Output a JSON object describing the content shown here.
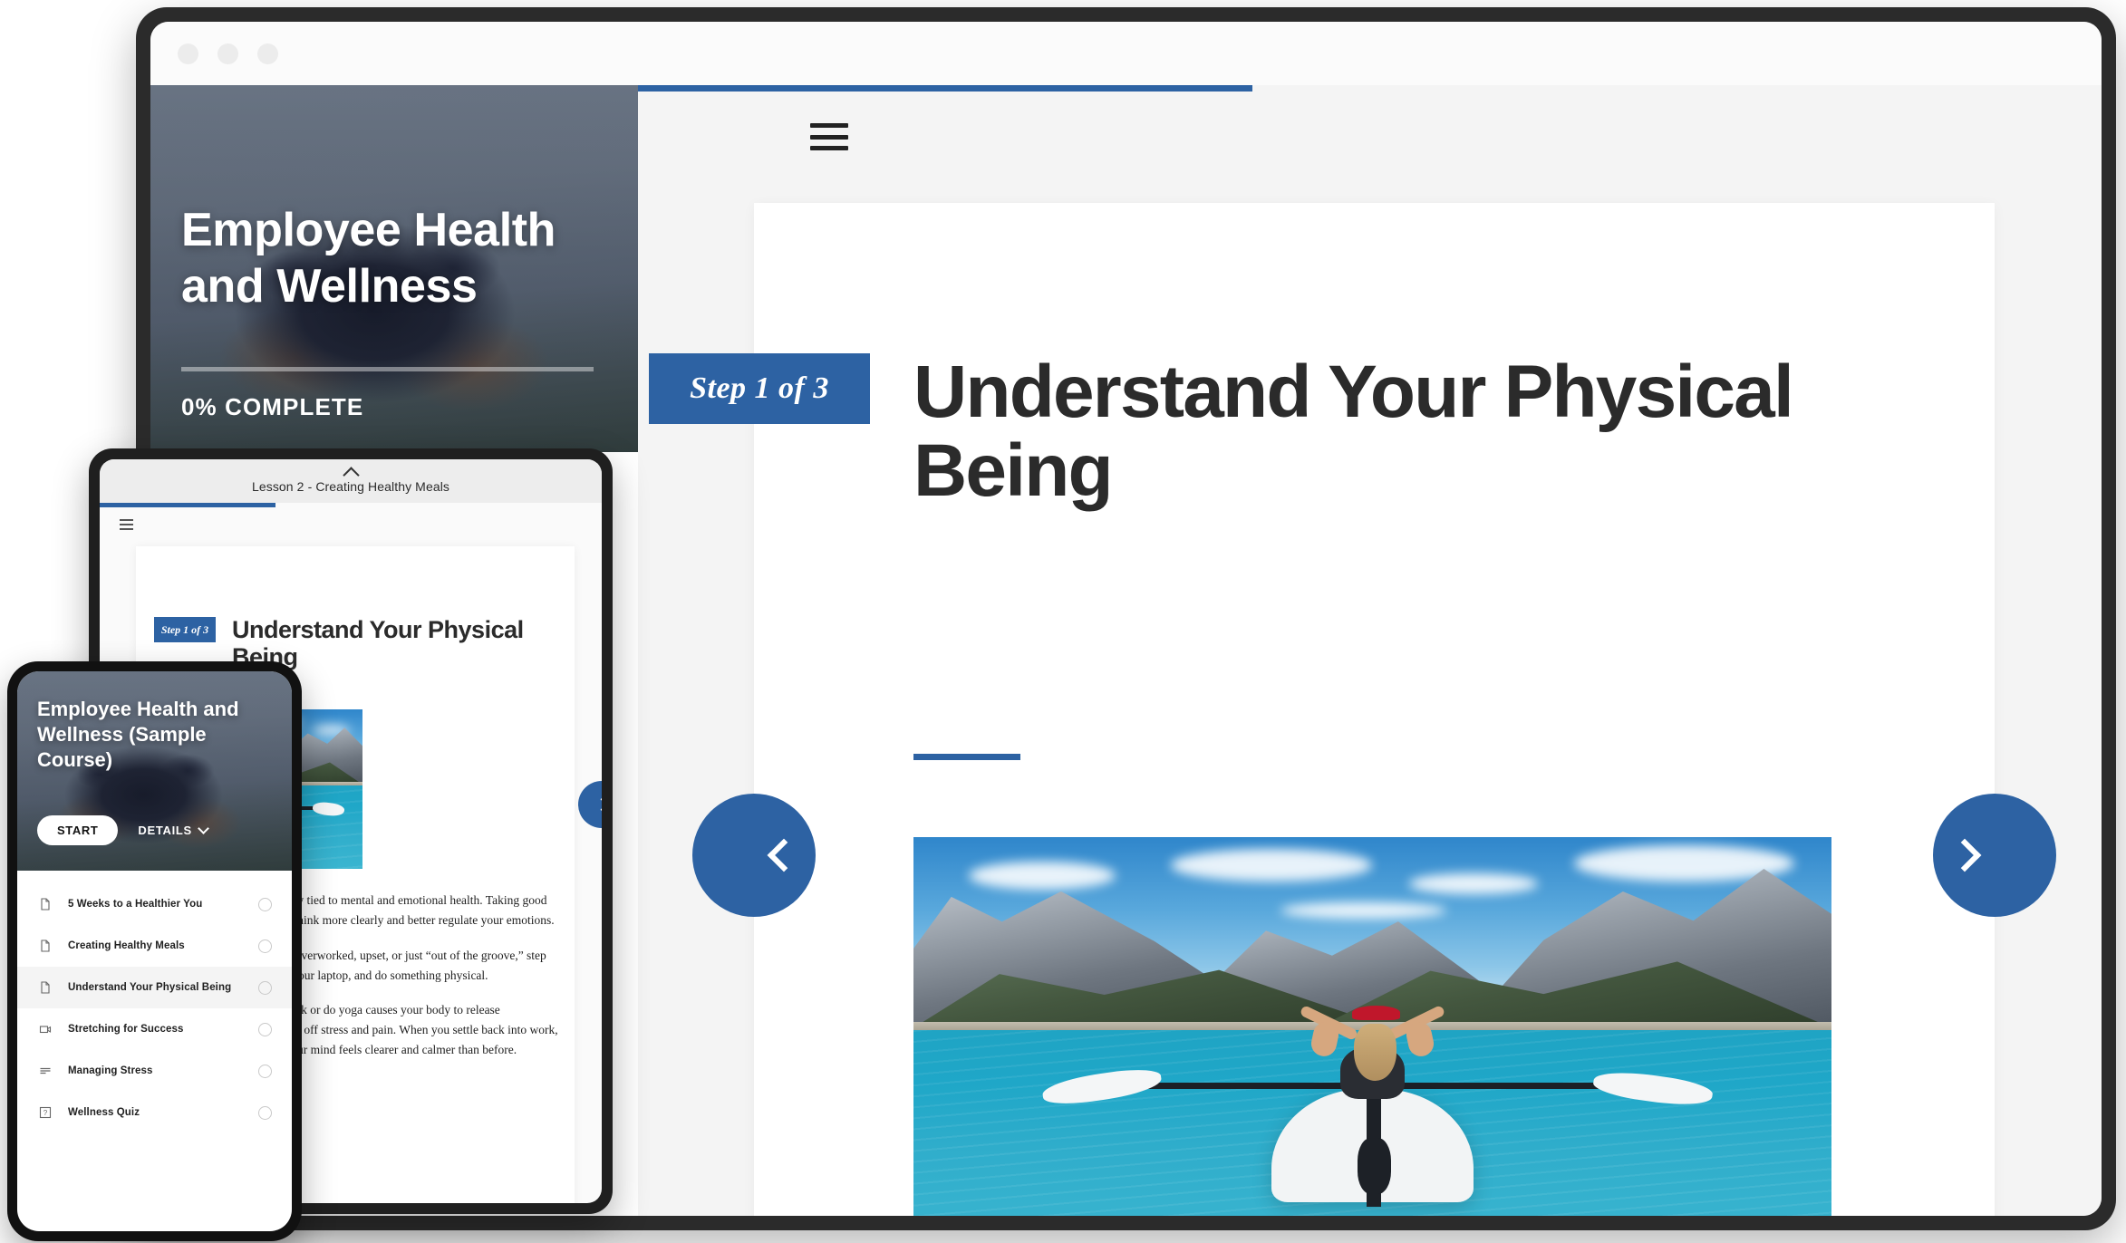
{
  "colors": {
    "brand_blue": "#2d62a3",
    "dark_text": "#2b2b2b",
    "bezel": "#2b2b2b"
  },
  "desktop": {
    "window_controls": [
      "close",
      "minimize",
      "maximize"
    ],
    "course": {
      "title": "Employee Health and Wellness",
      "progress_label": "0% COMPLETE",
      "progress_percent": 0
    },
    "menu_icon": "hamburger-menu-icon",
    "lesson": {
      "step_badge": "Step 1 of 3",
      "title": "Understand Your Physical Being",
      "image_alt": "woman kayaking on turquoise mountain lake"
    },
    "nav": {
      "prev_icon": "chevron-left-icon",
      "next_icon": "chevron-right-icon"
    }
  },
  "tablet": {
    "lesson_bar": {
      "label": "Lesson 2 - Creating Healthy Meals",
      "collapse_icon": "chevron-up-icon",
      "progress_percent": 35
    },
    "menu_icon": "hamburger-menu-icon",
    "lesson": {
      "step_badge": "Step 1 of 3",
      "title": "Understand Your Physical Being"
    },
    "body": [
      "Your physical health is closely tied to mental and emotional health. Taking good care of your body helps you think more clearly and better regulate your emotions.",
      "The next time you're feeling overworked, upset, or just “out of the groove,” step away from your desk, close your laptop, and do something physical.",
      "Taking a break to go for a walk or do yoga causes your body to release endorphins, helping you stave off stress and pain. When you settle back into work, you're likely to notice that your mind feels clearer and calmer than before."
    ],
    "next_icon": "chevron-right-icon"
  },
  "phone": {
    "course_title": "Employee Health and Wellness (Sample Course)",
    "start_label": "START",
    "details_label": "DETAILS",
    "details_icon": "chevron-down-icon",
    "lessons": [
      {
        "label": "5 Weeks to a Healthier You",
        "icon": "lesson-page-icon",
        "active": false,
        "status_icon": "progress-circle-icon"
      },
      {
        "label": "Creating Healthy Meals",
        "icon": "lesson-page-icon",
        "active": false,
        "status_icon": "progress-circle-icon"
      },
      {
        "label": "Understand Your Physical Being",
        "icon": "lesson-page-icon",
        "active": true,
        "status_icon": "progress-circle-icon"
      },
      {
        "label": "Stretching for Success",
        "icon": "video-camera-icon",
        "active": false,
        "status_icon": "progress-circle-icon"
      },
      {
        "label": "Managing Stress",
        "icon": "text-lines-icon",
        "active": false,
        "status_icon": "progress-circle-icon"
      },
      {
        "label": "Wellness Quiz",
        "icon": "quiz-question-icon",
        "active": false,
        "status_icon": "progress-circle-icon"
      }
    ]
  }
}
